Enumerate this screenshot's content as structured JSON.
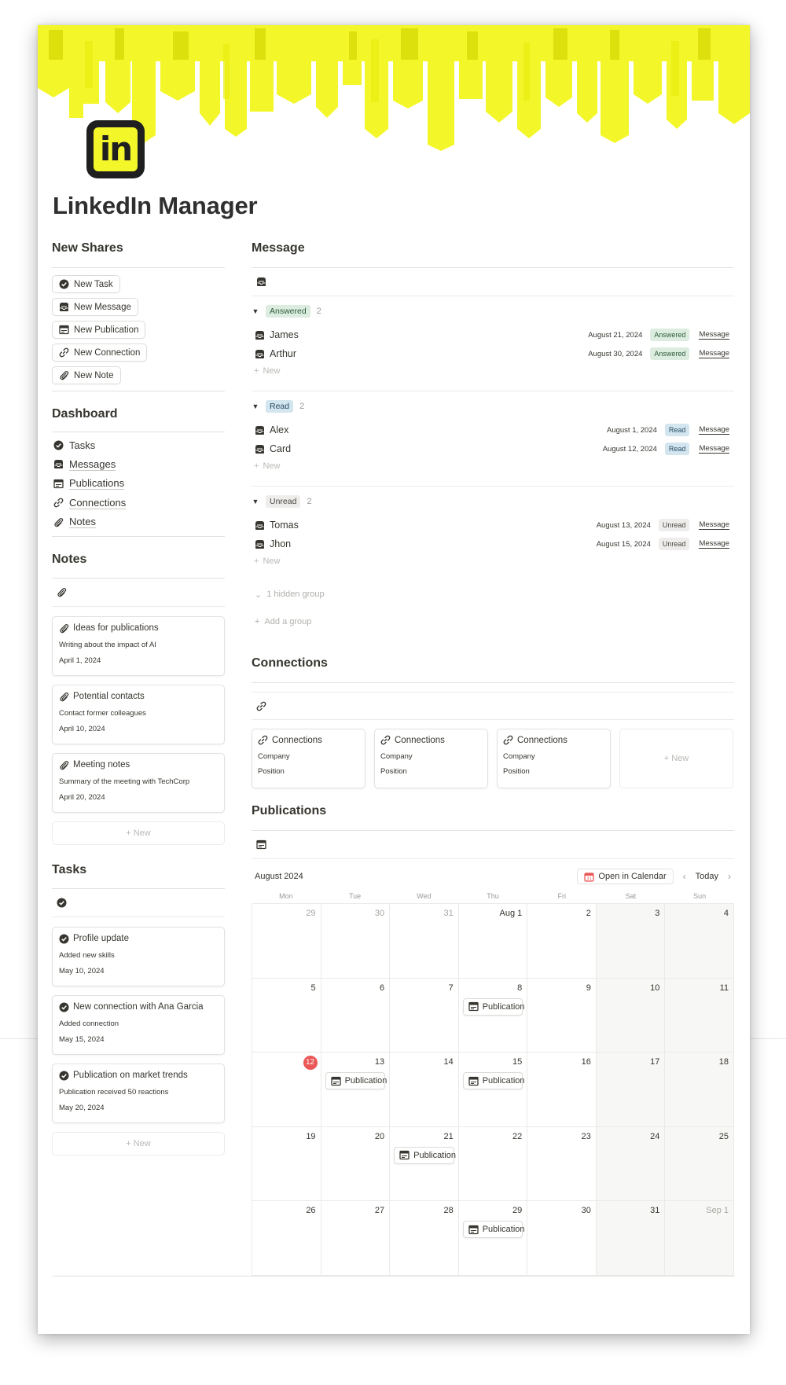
{
  "page": {
    "title": "LinkedIn Manager",
    "icon_text": "in"
  },
  "colors": {
    "cover_yellow": "#f3f72a",
    "accent_red": "#eb5757"
  },
  "left": {
    "new_shares": {
      "heading": "New Shares",
      "buttons": [
        {
          "label": "New Task",
          "icon": "check-circle-icon"
        },
        {
          "label": "New Message",
          "icon": "inbox-icon"
        },
        {
          "label": "New Publication",
          "icon": "publication-icon"
        },
        {
          "label": "New Connection",
          "icon": "link-icon"
        },
        {
          "label": "New Note",
          "icon": "paperclip-icon"
        }
      ]
    },
    "dashboard": {
      "heading": "Dashboard",
      "items": [
        {
          "label": "Tasks",
          "icon": "check-circle-icon"
        },
        {
          "label": "Messages",
          "icon": "inbox-icon"
        },
        {
          "label": "Publications",
          "icon": "publication-icon"
        },
        {
          "label": "Connections",
          "icon": "link-icon"
        },
        {
          "label": "Notes",
          "icon": "paperclip-icon"
        }
      ]
    },
    "notes": {
      "heading": "Notes",
      "cards": [
        {
          "title": "Ideas for publications",
          "text": "Writing about the impact of AI",
          "date": "April 1, 2024"
        },
        {
          "title": "Potential contacts",
          "text": "Contact former colleagues",
          "date": "April 10, 2024"
        },
        {
          "title": "Meeting notes",
          "text": "Summary of the meeting with TechCorp",
          "date": "April 20, 2024"
        }
      ],
      "new_label": "New"
    },
    "tasks": {
      "heading": "Tasks",
      "cards": [
        {
          "title": "Profile update",
          "text": "Added new skills",
          "date": "May 10, 2024"
        },
        {
          "title": "New connection with Ana Garcia",
          "text": "Added connection",
          "date": "May 15, 2024"
        },
        {
          "title": "Publication on market trends",
          "text": "Publication received 50 reactions",
          "date": "May 20, 2024"
        }
      ],
      "new_label": "New"
    }
  },
  "message": {
    "heading": "Message",
    "groups": [
      {
        "status": "Answered",
        "count": "2",
        "rows": [
          {
            "name": "James",
            "date": "August 21, 2024",
            "status": "Answered",
            "link": "Message"
          },
          {
            "name": "Arthur",
            "date": "August 30, 2024",
            "status": "Answered",
            "link": "Message"
          }
        ]
      },
      {
        "status": "Read",
        "count": "2",
        "rows": [
          {
            "name": "Alex",
            "date": "August 1, 2024",
            "status": "Read",
            "link": "Message"
          },
          {
            "name": "Card",
            "date": "August 12, 2024",
            "status": "Read",
            "link": "Message"
          }
        ]
      },
      {
        "status": "Unread",
        "count": "2",
        "rows": [
          {
            "name": "Tomas",
            "date": "August 13, 2024",
            "status": "Unread",
            "link": "Message"
          },
          {
            "name": "Jhon",
            "date": "August 15, 2024",
            "status": "Unread",
            "link": "Message"
          }
        ]
      }
    ],
    "new_label": "New",
    "hidden_group": "1 hidden group",
    "add_group": "Add a group"
  },
  "connections": {
    "heading": "Connections",
    "cards": [
      {
        "title": "Connections",
        "company": "Company",
        "position": "Position"
      },
      {
        "title": "Connections",
        "company": "Company",
        "position": "Position"
      },
      {
        "title": "Connections",
        "company": "Company",
        "position": "Position"
      }
    ],
    "new_label": "New"
  },
  "publications": {
    "heading": "Publications",
    "month": "August 2024",
    "open_calendar": "Open in Calendar",
    "today": "Today",
    "weekdays": [
      "Mon",
      "Tue",
      "Wed",
      "Thu",
      "Fri",
      "Sat",
      "Sun"
    ],
    "days": [
      "29",
      "30",
      "31",
      "Aug 1",
      "2",
      "3",
      "4",
      "5",
      "6",
      "7",
      "8",
      "9",
      "10",
      "11",
      "12",
      "13",
      "14",
      "15",
      "16",
      "17",
      "18",
      "19",
      "20",
      "21",
      "22",
      "23",
      "24",
      "25",
      "26",
      "27",
      "28",
      "29",
      "30",
      "31",
      "Sep 1"
    ],
    "today_day": "12",
    "event_label": "Publication",
    "event_days": [
      "8",
      "13",
      "15",
      "21",
      "29"
    ]
  }
}
